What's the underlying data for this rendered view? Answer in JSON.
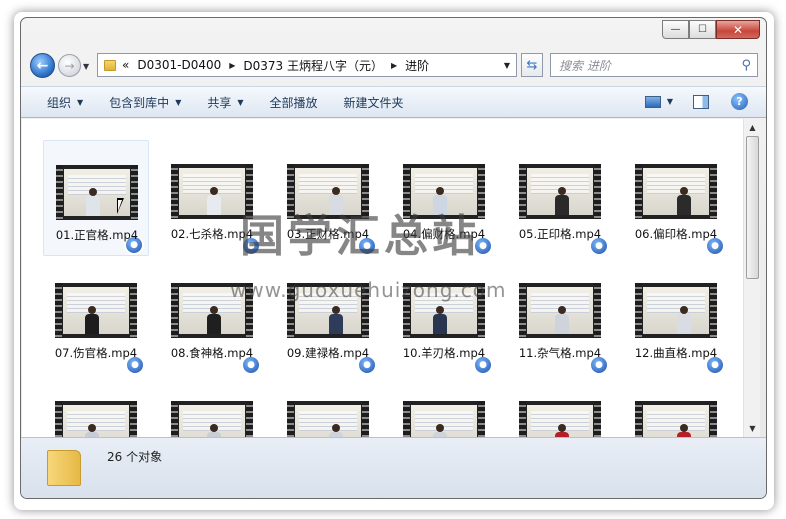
{
  "window": {
    "caption": {
      "minimize": "—",
      "maximize": "☐",
      "close": "✕"
    }
  },
  "nav": {
    "breadcrumb_overflow": "«",
    "crumbs": [
      "D0301-D0400",
      "D0373 王炳程八字（元）",
      "进阶"
    ],
    "search_placeholder": "搜索 进阶"
  },
  "toolbar": {
    "organize": "组织",
    "include_in_library": "包含到库中",
    "share": "共享",
    "play_all": "全部播放",
    "new_folder": "新建文件夹"
  },
  "files": [
    {
      "name": "01.正官格.mp4"
    },
    {
      "name": "02.七杀格.mp4"
    },
    {
      "name": "03.正财格.mp4"
    },
    {
      "name": "04.偏财格.mp4"
    },
    {
      "name": "05.正印格.mp4"
    },
    {
      "name": "06.偏印格.mp4"
    },
    {
      "name": "07.伤官格.mp4"
    },
    {
      "name": "08.食神格.mp4"
    },
    {
      "name": "09.建禄格.mp4"
    },
    {
      "name": "10.羊刃格.mp4"
    },
    {
      "name": "11.杂气格.mp4"
    },
    {
      "name": "12.曲直格.mp4"
    },
    {
      "name": ""
    },
    {
      "name": ""
    },
    {
      "name": ""
    },
    {
      "name": ""
    },
    {
      "name": ""
    },
    {
      "name": ""
    }
  ],
  "status": {
    "count_text": "26 个对象"
  },
  "watermark": {
    "title": "国学汇总站",
    "url": "www.guoxuehuizong.com"
  },
  "colors": {
    "toolbar_text": "#1e395b",
    "accent": "#2f6ab5",
    "close": "#c7463a"
  }
}
